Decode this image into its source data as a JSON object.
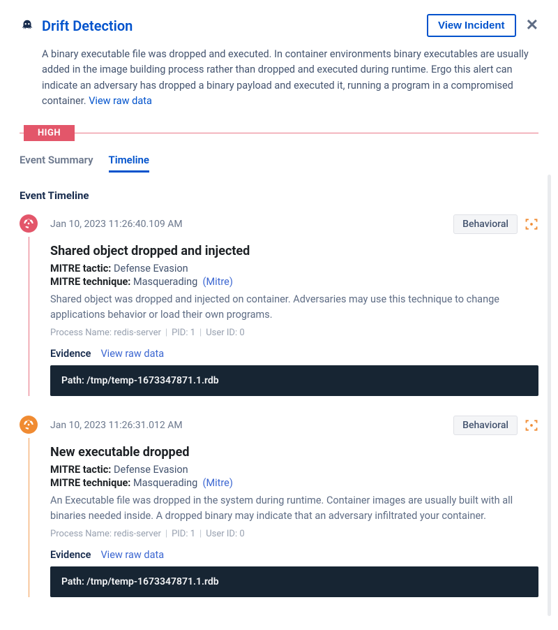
{
  "header": {
    "title": "Drift Detection",
    "view_incident": "View Incident"
  },
  "description": {
    "text": "A binary executable file was dropped and executed. In container environments binary executables are usually added in the image building process rather than dropped and executed during runtime. Ergo this alert can indicate an adversary has dropped a binary payload and executed it, running a program in a compromised container.",
    "link": "View raw data"
  },
  "severity": "HIGH",
  "tabs": {
    "summary": "Event Summary",
    "timeline": "Timeline"
  },
  "section_heading": "Event Timeline",
  "labels": {
    "behavioral": "Behavioral",
    "mitre_tactic": "MITRE tactic:",
    "mitre_technique": "MITRE technique:",
    "mitre_link": "(Mitre)",
    "process_name": "Process Name:",
    "pid": "PID:",
    "user_id": "User ID:",
    "evidence": "Evidence",
    "view_raw": "View raw data",
    "path": "Path:"
  },
  "events": [
    {
      "severity": "red",
      "timestamp": "Jan 10, 2023 11:26:40.109 AM",
      "title": "Shared object dropped and injected",
      "tactic": "Defense Evasion",
      "technique": "Masquerading",
      "description": "Shared object was dropped and injected on container. Adversaries may use this technique to change applications behavior or load their own programs.",
      "process_name": "redis-server",
      "pid": "1",
      "user_id": "0",
      "path": "/tmp/temp-1673347871.1.rdb"
    },
    {
      "severity": "orange",
      "timestamp": "Jan 10, 2023 11:26:31.012 AM",
      "title": "New executable dropped",
      "tactic": "Defense Evasion",
      "technique": "Masquerading",
      "description": "An Executable file was dropped in the system during runtime. Container images are usually built with all binaries needed inside. A dropped binary may indicate that an adversary infiltrated your container.",
      "process_name": "redis-server",
      "pid": "1",
      "user_id": "0",
      "path": "/tmp/temp-1673347871.1.rdb"
    }
  ]
}
